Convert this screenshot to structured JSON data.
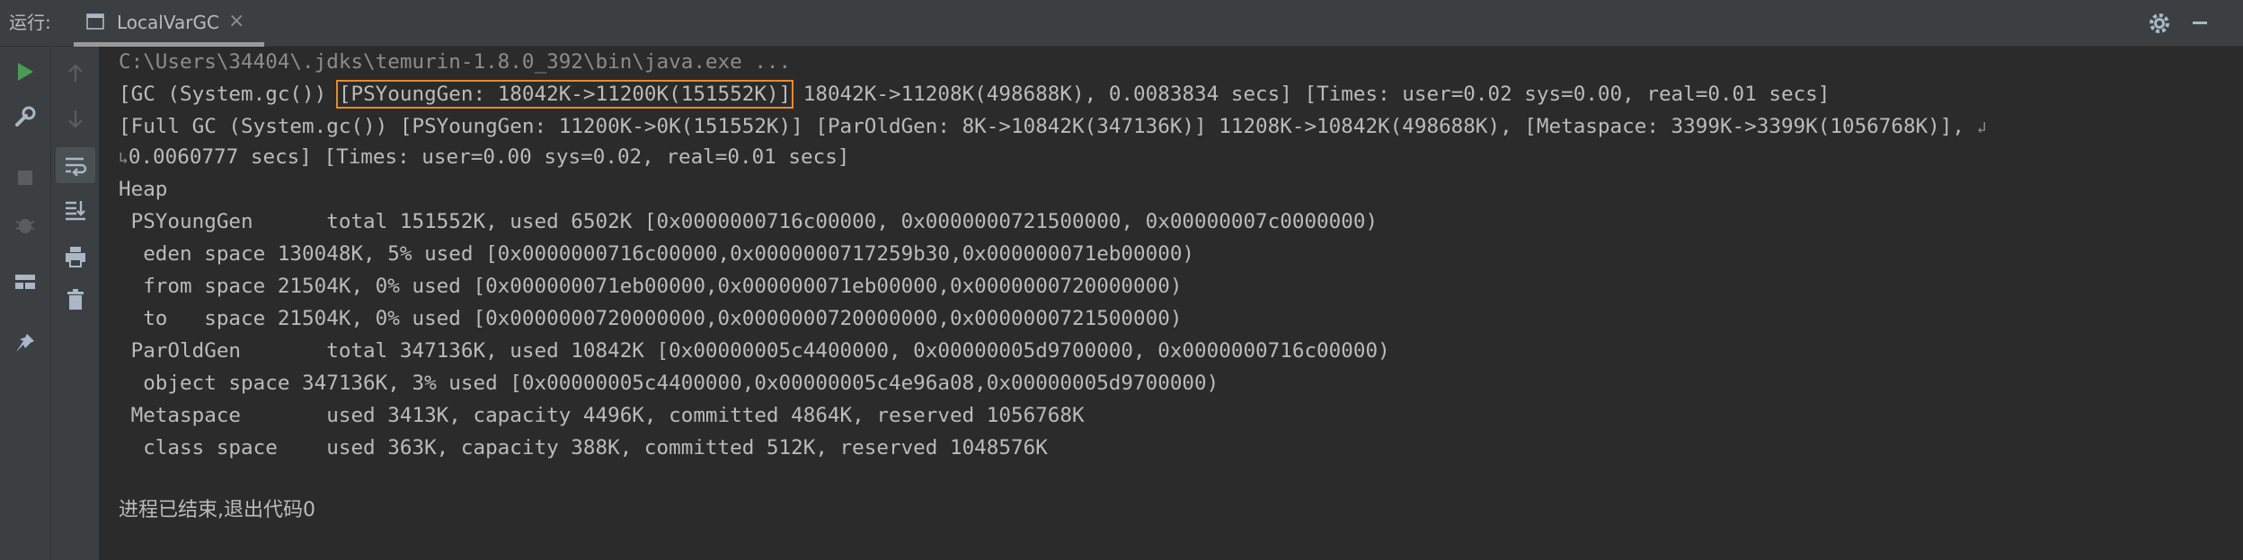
{
  "run_bar": {
    "run_label": "运行:",
    "tab_title": "LocalVarGC",
    "tab_close": "×"
  },
  "toolbar": {
    "buttons": [
      "rerun-icon",
      "wrench-icon",
      "stop-icon",
      "debug-bug-icon",
      "layout-icon",
      "pin-icon",
      "up-arrow-icon",
      "down-arrow-icon",
      "soft-wrap-icon",
      "scroll-to-end-icon",
      "print-icon",
      "trash-icon"
    ]
  },
  "console": {
    "command_line": "C:\\Users\\34404\\.jdks\\temurin-1.8.0_392\\bin\\java.exe ...",
    "gc_line": {
      "prefix": "[GC (System.gc()) ",
      "highlight": "[PSYoungGen: 18042K->11200K(151552K)]",
      "suffix": " 18042K->11208K(498688K), 0.0083834 secs] [Times: user=0.02 sys=0.00, real=0.01 secs]"
    },
    "full_gc_line1": "[Full GC (System.gc()) [PSYoungGen: 11200K->0K(151552K)] [ParOldGen: 8K->10842K(347136K)] 11208K->10842K(498688K), [Metaspace: 3399K->3399K(1056768K)],",
    "full_gc_line2": "0.0060777 secs] [Times: user=0.00 sys=0.02, real=0.01 secs]",
    "wrap_glyph_end": "↲",
    "wrap_glyph_start": "↳",
    "heap_lines": [
      "Heap",
      " PSYoungGen      total 151552K, used 6502K [0x0000000716c00000, 0x0000000721500000, 0x00000007c0000000)",
      "  eden space 130048K, 5% used [0x0000000716c00000,0x0000000717259b30,0x000000071eb00000)",
      "  from space 21504K, 0% used [0x000000071eb00000,0x000000071eb00000,0x0000000720000000)",
      "  to   space 21504K, 0% used [0x0000000720000000,0x0000000720000000,0x0000000721500000)",
      " ParOldGen       total 347136K, used 10842K [0x00000005c4400000, 0x00000005d9700000, 0x0000000716c00000)",
      "  object space 347136K, 3% used [0x00000005c4400000,0x00000005c4e96a08,0x00000005d9700000)",
      " Metaspace       used 3413K, capacity 4496K, committed 4864K, reserved 1056768K",
      "  class space    used 363K, capacity 388K, committed 512K, reserved 1048576K"
    ],
    "exit_message": "进程已结束,退出代码0"
  },
  "colors": {
    "background": "#2b2b2b",
    "toolbar": "#3c3f41",
    "text": "#bbbbbb",
    "highlight_border": "#e98a2b",
    "run_green": "#499c54"
  }
}
